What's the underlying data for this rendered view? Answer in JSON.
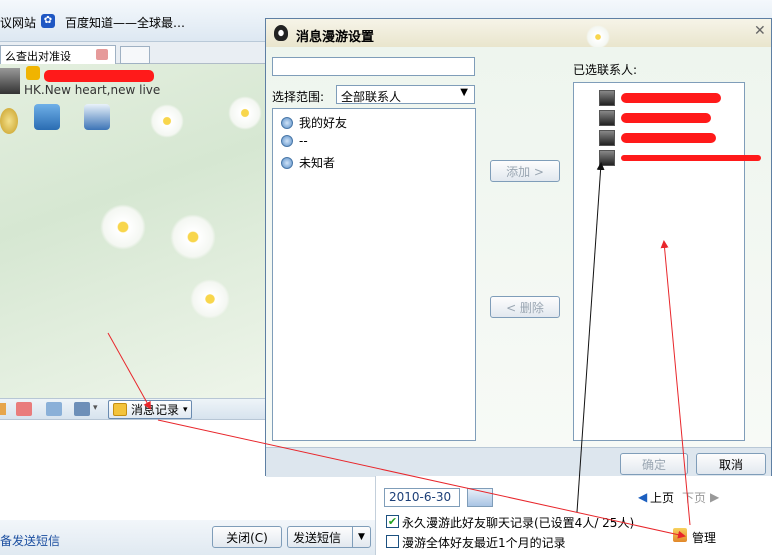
{
  "favorites": {
    "item1": "议网站",
    "item2": "百度知道——全球最…"
  },
  "chat": {
    "tab_label": "么查出对准设",
    "signature": "HK.New heart,new live",
    "history_button": "消息记录",
    "sms_link": "备发送短信",
    "close_button": "关闭(C)",
    "send_button": "发送短信"
  },
  "dialog": {
    "title": "消息漫游设置",
    "search_placeholder": "",
    "scope_label": "选择范围:",
    "scope_value": "全部联系人",
    "tree": [
      "我的好友",
      "--",
      "未知者"
    ],
    "add_button": "添加 >",
    "remove_button": "< 删除",
    "selected_label": "已选联系人:",
    "ok_button": "确定",
    "cancel_button": "取消"
  },
  "history": {
    "date": "2010-6-30",
    "prev_page": "上页",
    "next_page": "下页",
    "option1": "永久漫游此好友聊天记录(已设置4人/ 25人)",
    "option2": "漫游全体好友最近1个月的记录",
    "manage": "管理"
  },
  "colors": {
    "annotation_red": "#e8262b",
    "annotation_black": "#111111",
    "accent_blue": "#1c5180"
  }
}
